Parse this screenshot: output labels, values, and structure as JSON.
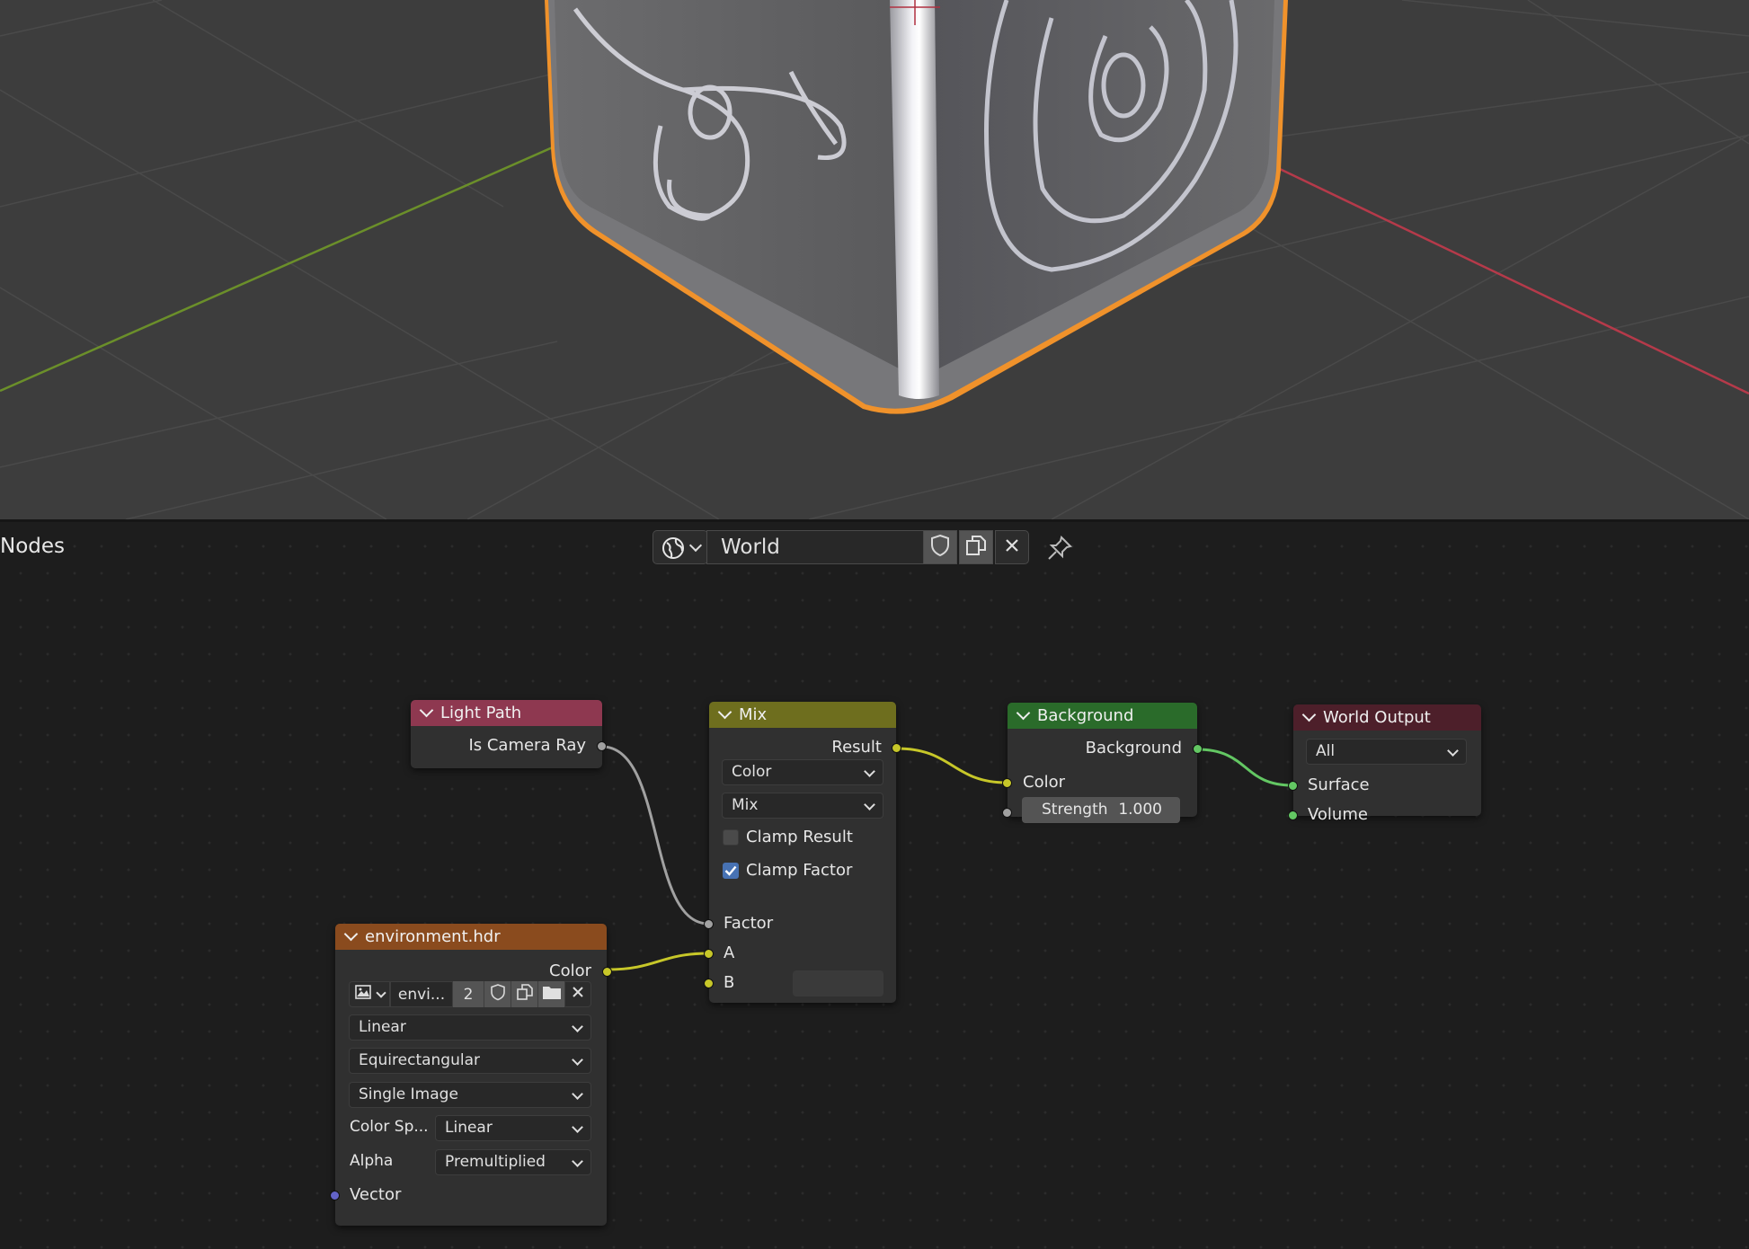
{
  "editor": {
    "label": "Nodes",
    "datablock": {
      "name": "World"
    }
  },
  "nodes": {
    "light_path": {
      "title": "Light Path",
      "output": "Is Camera Ray",
      "header_color": "#8e3850"
    },
    "mix": {
      "title": "Mix",
      "output": "Result",
      "data_type": "Color",
      "blend_mode": "Mix",
      "clamp_result": {
        "label": "Clamp Result",
        "checked": false
      },
      "clamp_factor": {
        "label": "Clamp Factor",
        "checked": true
      },
      "inputs": {
        "factor": "Factor",
        "a": "A",
        "b": "B"
      },
      "header_color": "#6e6e1e"
    },
    "background": {
      "title": "Background",
      "output": "Background",
      "input_color": "Color",
      "strength_label": "Strength",
      "strength_value": "1.000",
      "header_color": "#2a6b2a"
    },
    "world_output": {
      "title": "World Output",
      "target": "All",
      "inputs": {
        "surface": "Surface",
        "volume": "Volume"
      },
      "header_color": "#4d1f2a"
    },
    "environment": {
      "title": "environment.hdr",
      "output": "Color",
      "image_name": "envi...",
      "users": "2",
      "interpolation": "Linear",
      "projection": "Equirectangular",
      "source": "Single Image",
      "color_space_label": "Color Sp...",
      "color_space": "Linear",
      "alpha_label": "Alpha",
      "alpha_mode": "Premultiplied",
      "input_vector": "Vector",
      "header_color": "#8a4b1e"
    }
  },
  "colors": {
    "socket_color": "#c7c729",
    "socket_shader": "#63c763",
    "socket_float": "#a1a1a1",
    "socket_vector": "#6363c7",
    "selection_outline": "#f0922b",
    "axis_x": "#b53a4a",
    "axis_y": "#6b8f2a",
    "checkbox_on": "#4772b3"
  }
}
